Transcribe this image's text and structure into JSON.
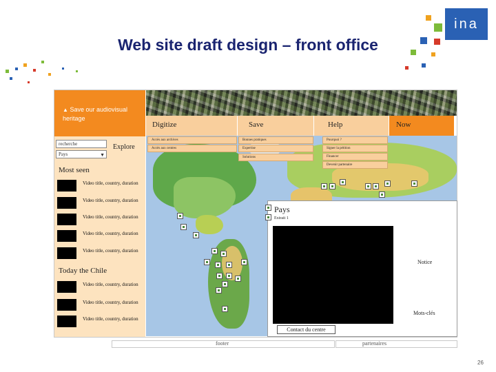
{
  "slide": {
    "title": "Web site draft design – front office",
    "logo_text": "ina",
    "page_number": "26"
  },
  "left_panel": {
    "banner_text": "Save our audiovisual heritage",
    "banner_icon": "play-triangle-icon",
    "search_value": "recherche",
    "select_value": "Pays",
    "explore_label": "Explore",
    "most_seen_title": "Most seen",
    "most_seen_items": [
      "Video title, country, duration",
      "Video title, country, duration",
      "Video title, country, duration",
      "Video title, country, duration",
      "Video title, country, duration"
    ],
    "today_title": "Today the Chile",
    "today_items": [
      "Video title, country, duration",
      "Video title, country, duration",
      "Video title, country, duration"
    ]
  },
  "nav": {
    "items": [
      "Digitize",
      "Save",
      "Help",
      "Now"
    ],
    "digitize_sub": [
      "Accès aux archives",
      "Accès aux centres"
    ],
    "save_sub": [
      "Bonnes pratiques",
      "Expertise",
      "Solutions"
    ],
    "help_sub": [
      "Pourquoi ?",
      "Signer la pétition",
      "Financer",
      "Devenir partenaire"
    ]
  },
  "popup": {
    "title": "Pays",
    "subtitle": "Extrait 1",
    "notice_label": "Notice",
    "keywords_label": "Mots-clés",
    "contact_label": "Contact du centre"
  },
  "footer": {
    "footer_label": "footer",
    "partners_label": "partenaires"
  },
  "colors": {
    "accent_orange": "#f38a1f",
    "nav_light": "#f9cf9d",
    "panel_bg": "#fde3bf",
    "title_blue": "#1a2470",
    "map_ocean": "#a7c6e6"
  }
}
